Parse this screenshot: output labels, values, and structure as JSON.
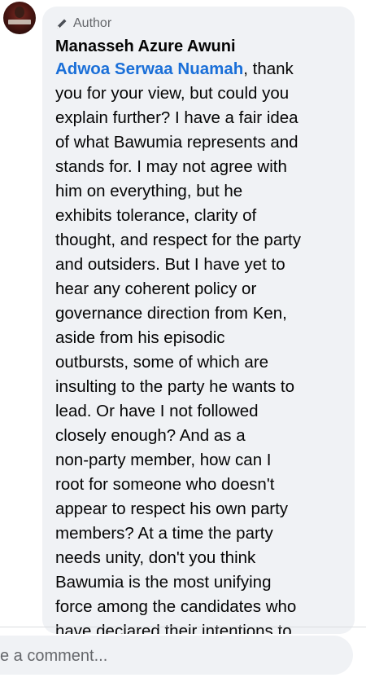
{
  "comment": {
    "badge_label": "Author",
    "badge_icon": "pencil-icon",
    "author_name": "Manasseh Azure Awuni",
    "mention": "Adwoa Serwaa Nuamah",
    "text_lines": [
      ", thank",
      "you for your view, but could you",
      "explain further? I have a fair idea",
      "of what Bawumia represents and",
      "stands for. I may not agree with",
      "him on everything, but he",
      "exhibits tolerance, clarity of",
      "thought, and respect for the party",
      "and outsiders. But I have yet to",
      "hear any coherent policy or",
      "governance direction from Ken,",
      "aside from his episodic",
      "outbursts, some of which are",
      "insulting to the party he wants to",
      "lead. Or have I not followed",
      "closely enough? And as a",
      "non-party member, how can I",
      "root for someone who doesn't",
      "appear to respect his own party",
      "members? At a time the party",
      "needs unity, don't you think",
      "Bawumia is the most unifying",
      "force among the candidates who",
      "have declared their intentions to"
    ],
    "mention_color": "#1a6fd8"
  },
  "composer": {
    "placeholder": "e a comment..."
  },
  "colors": {
    "bubble_background": "#f0f2f5",
    "secondary_text": "#65676b",
    "primary_text": "#050505"
  }
}
